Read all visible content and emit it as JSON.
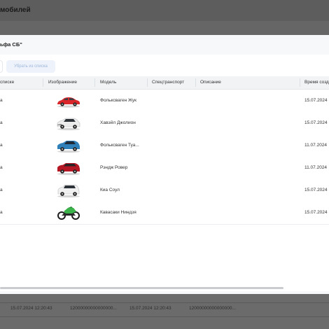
{
  "page": {
    "title": "мобилей"
  },
  "background_rows": [
    {
      "date": "15.07.2024 12:20:43",
      "number": "12000000000000000...",
      "date2": "15.07.2024 12:20:43",
      "number2": "12000000000000000..."
    },
    {
      "date": "",
      "number": "",
      "date2": "",
      "number2": ""
    }
  ],
  "modal": {
    "title": "ьфа СБ\"",
    "remove_button": "Убрать из списка",
    "columns": {
      "in_list": "списке",
      "image": "Изображение",
      "model": "Модель",
      "special": "Спецтранспорт",
      "description": "Описание",
      "created": "Время созд"
    },
    "rows": [
      {
        "in_list": "а",
        "image": "car-red-icon",
        "image_color": "#d8262b",
        "model": "Фольксваген Жук",
        "special": "",
        "description": "",
        "created": "15.07.2024"
      },
      {
        "in_list": "а",
        "image": "car-white-suv-icon",
        "image_color": "#ececec",
        "model": "Хавэйл Джолион",
        "special": "",
        "description": "",
        "created": "15.07.2024"
      },
      {
        "in_list": "а",
        "image": "car-blue-icon",
        "image_color": "#2f7fb8",
        "model": "Фольксваген Туа...",
        "special": "",
        "description": "",
        "created": "11.07.2024"
      },
      {
        "in_list": "а",
        "image": "car-red-suv-icon",
        "image_color": "#b51824",
        "model": "Рэндж Ровер",
        "special": "",
        "description": "",
        "created": "11.07.2024"
      },
      {
        "in_list": "а",
        "image": "car-white-icon",
        "image_color": "#f0f0f0",
        "model": "Киа Соул",
        "special": "",
        "description": "",
        "created": "15.07.2024"
      },
      {
        "in_list": "а",
        "image": "motorcycle-icon",
        "image_color": "#3cb34a",
        "model": "Кавасаки Ниндзя",
        "special": "",
        "description": "",
        "created": "15.07.2024"
      }
    ]
  }
}
